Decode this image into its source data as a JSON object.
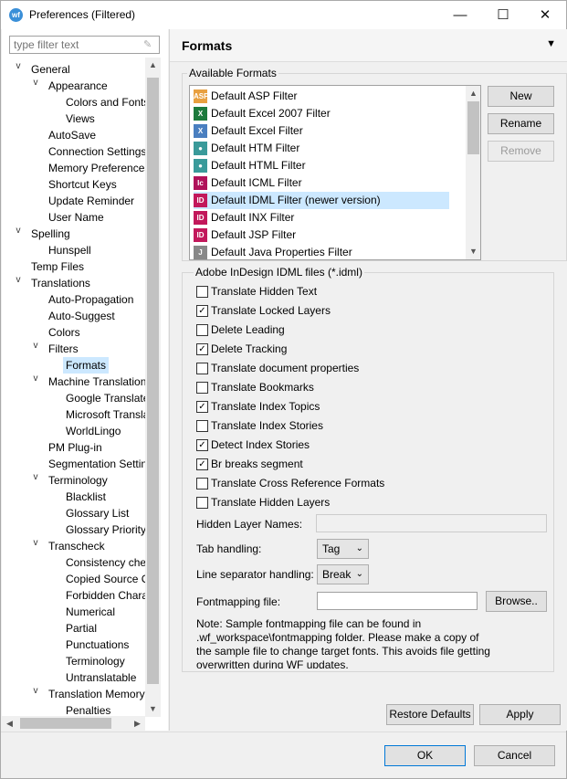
{
  "window": {
    "title": "Preferences (Filtered)",
    "app_icon_text": "wf",
    "min_glyph": "—",
    "max_glyph": "☐",
    "close_glyph": "✕"
  },
  "filter": {
    "placeholder": "type filter text"
  },
  "tree": [
    {
      "label": "General",
      "expand": "v"
    },
    {
      "label": "Appearance",
      "expand": "v"
    },
    {
      "label": "Colors and Fonts",
      "expand": ""
    },
    {
      "label": "Views",
      "expand": ""
    },
    {
      "label": "AutoSave",
      "expand": ""
    },
    {
      "label": "Connection Settings",
      "expand": ""
    },
    {
      "label": "Memory Preferences",
      "expand": ""
    },
    {
      "label": "Shortcut Keys",
      "expand": ""
    },
    {
      "label": "Update Reminder",
      "expand": ""
    },
    {
      "label": "User Name",
      "expand": ""
    },
    {
      "label": "Spelling",
      "expand": "v"
    },
    {
      "label": "Hunspell",
      "expand": ""
    },
    {
      "label": "Temp Files",
      "expand": ""
    },
    {
      "label": "Translations",
      "expand": "v"
    },
    {
      "label": "Auto-Propagation",
      "expand": ""
    },
    {
      "label": "Auto-Suggest",
      "expand": ""
    },
    {
      "label": "Colors",
      "expand": ""
    },
    {
      "label": "Filters",
      "expand": "v"
    },
    {
      "label": "Formats",
      "expand": "",
      "selected": true
    },
    {
      "label": "Machine Translation",
      "expand": "v"
    },
    {
      "label": "Google Translate",
      "expand": ""
    },
    {
      "label": "Microsoft Translator",
      "expand": ""
    },
    {
      "label": "WorldLingo",
      "expand": ""
    },
    {
      "label": "PM Plug-in",
      "expand": ""
    },
    {
      "label": "Segmentation Settings",
      "expand": ""
    },
    {
      "label": "Terminology",
      "expand": "v"
    },
    {
      "label": "Blacklist",
      "expand": ""
    },
    {
      "label": "Glossary List",
      "expand": ""
    },
    {
      "label": "Glossary Priority",
      "expand": ""
    },
    {
      "label": "Transcheck",
      "expand": "v"
    },
    {
      "label": "Consistency check",
      "expand": ""
    },
    {
      "label": "Copied Source Check",
      "expand": ""
    },
    {
      "label": "Forbidden Characters",
      "expand": ""
    },
    {
      "label": "Numerical",
      "expand": ""
    },
    {
      "label": "Partial",
      "expand": ""
    },
    {
      "label": "Punctuations",
      "expand": ""
    },
    {
      "label": "Terminology",
      "expand": ""
    },
    {
      "label": "Untranslatable",
      "expand": ""
    },
    {
      "label": "Translation Memory",
      "expand": "v"
    },
    {
      "label": "Penalties",
      "expand": ""
    }
  ],
  "page": {
    "title": "Formats",
    "menu_glyph": "▼",
    "available_formats_label": "Available Formats",
    "formats": [
      {
        "label": "Default ASP Filter",
        "icon": "asp-file-icon",
        "color": "#e8a040",
        "glyph": "ASP"
      },
      {
        "label": "Default Excel 2007 Filter",
        "icon": "excel-file-icon",
        "color": "#1d7a3d",
        "glyph": "X"
      },
      {
        "label": "Default Excel Filter",
        "icon": "excel-file-icon",
        "color": "#4a7fc0",
        "glyph": "X"
      },
      {
        "label": "Default HTM Filter",
        "icon": "htm-file-icon",
        "color": "#3a9a9a",
        "glyph": "●"
      },
      {
        "label": "Default HTML Filter",
        "icon": "html-file-icon",
        "color": "#3a9a9a",
        "glyph": "●"
      },
      {
        "label": "Default ICML Filter",
        "icon": "icml-file-icon",
        "color": "#b0125a",
        "glyph": "Ic"
      },
      {
        "label": "Default IDML Filter (newer version)",
        "icon": "idml-file-icon",
        "color": "#c2185b",
        "glyph": "ID",
        "selected": true
      },
      {
        "label": "Default INX Filter",
        "icon": "inx-file-icon",
        "color": "#c2185b",
        "glyph": "ID"
      },
      {
        "label": "Default JSP Filter",
        "icon": "jsp-file-icon",
        "color": "#c2185b",
        "glyph": "ID"
      },
      {
        "label": "Default Java Properties Filter",
        "icon": "java-file-icon",
        "color": "#888888",
        "glyph": "J"
      }
    ],
    "buttons": {
      "new": "New",
      "rename": "Rename",
      "remove": "Remove"
    },
    "idml_group_label": "Adobe InDesign IDML files (*.idml)",
    "checkboxes": [
      {
        "label": "Translate Hidden Text",
        "checked": false
      },
      {
        "label": "Translate Locked Layers",
        "checked": true
      },
      {
        "label": "Delete Leading",
        "checked": false
      },
      {
        "label": "Delete Tracking",
        "checked": true
      },
      {
        "label": "Translate document properties",
        "checked": false
      },
      {
        "label": "Translate Bookmarks",
        "checked": false
      },
      {
        "label": "Translate Index Topics",
        "checked": true
      },
      {
        "label": "Translate Index Stories",
        "checked": false
      },
      {
        "label": "Detect Index Stories",
        "checked": true
      },
      {
        "label": "Br breaks segment",
        "checked": true
      },
      {
        "label": "Translate Cross Reference Formats",
        "checked": false
      },
      {
        "label": "Translate Hidden Layers",
        "checked": false
      }
    ],
    "hidden_layer_names_label": "Hidden Layer Names:",
    "hidden_layer_names_value": "",
    "tab_handling_label": "Tab handling:",
    "tab_handling_value": "Tag",
    "line_sep_label": "Line separator handling:",
    "line_sep_value": "Break",
    "fontmapping_label": "Fontmapping file:",
    "fontmapping_value": "",
    "browse_label": "Browse..",
    "note_lines": [
      "Note: Sample fontmapping file can be found in",
      ".wf_workspace\\fontmapping folder. Please make a copy of",
      "the sample file to change target fonts. This avoids file getting",
      "overwritten during WF updates."
    ],
    "restore_defaults": "Restore Defaults",
    "apply": "Apply"
  },
  "dialog": {
    "ok": "OK",
    "cancel": "Cancel"
  }
}
